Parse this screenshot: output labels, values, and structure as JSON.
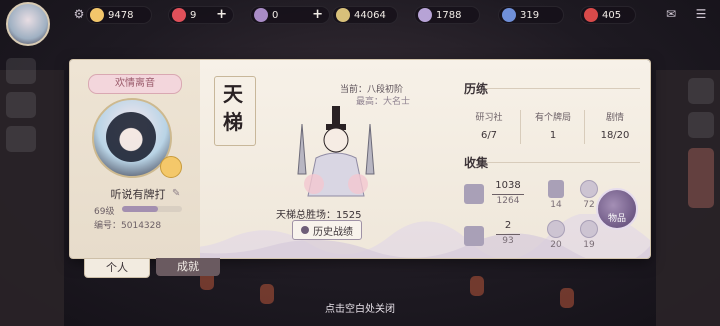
{
  "resources": [
    {
      "name": "coin",
      "value": "9478",
      "color": "#f2c66b"
    },
    {
      "name": "gem",
      "value": "9",
      "color": "#e0505a",
      "has_plus": true
    },
    {
      "name": "jade",
      "value": "0",
      "color": "#a98cc6",
      "has_plus": true
    },
    {
      "name": "scroll",
      "value": "44064",
      "color": "#d8c07a"
    },
    {
      "name": "orb",
      "value": "1788",
      "color": "#b7a3d6"
    },
    {
      "name": "crystal",
      "value": "319",
      "color": "#6f8fd8"
    },
    {
      "name": "ruby",
      "value": "405",
      "color": "#d84a4a"
    }
  ],
  "profile": {
    "title_chip": "欢情离音",
    "name": "听说有牌打",
    "level": "69级",
    "level_progress": 0.6,
    "id_label": "编号：",
    "id_value": "5014328"
  },
  "tianti": {
    "emblem": "天梯",
    "current": "当前：八段初阶",
    "best": "最高：大名士",
    "total_label": "天梯总胜场：",
    "total_value": "1525",
    "history_button": "历史战绩"
  },
  "practice": {
    "title": "历练",
    "stats": [
      {
        "label": "研习社",
        "value": "6/7"
      },
      {
        "label": "有个牌局",
        "value": "1"
      },
      {
        "label": "剧情",
        "value": "18/20"
      }
    ]
  },
  "collection": {
    "title": "收集",
    "cards": {
      "value": "1038",
      "total": "1264"
    },
    "card_deck": "14",
    "portrait_frame": "72",
    "costume": {
      "value": "2",
      "total": "93"
    },
    "emote": "20",
    "badge": "19",
    "items_button": "物品"
  },
  "tabs": {
    "personal": "个人",
    "achievement": "成就"
  },
  "close_hint": "点击空白处关闭"
}
